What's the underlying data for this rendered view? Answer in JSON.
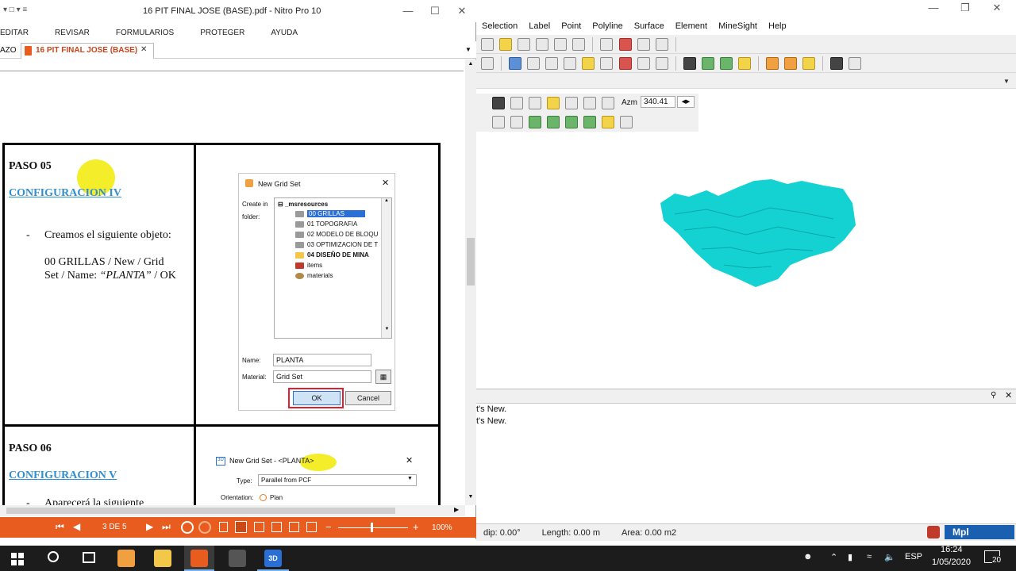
{
  "minesight": {
    "menu": [
      "Selection",
      "Label",
      "Point",
      "Polyline",
      "Surface",
      "Element",
      "MineSight",
      "Help"
    ],
    "azm_label": "Azm",
    "azm_value": "340.41",
    "messages": [
      "t's New.",
      "t's New."
    ],
    "status": {
      "dip": "dip: 0.00°",
      "length": "Length: 0.00 m",
      "area": "Area: 0.00 m2"
    },
    "mpl_label": "Mpl",
    "solid_color": "#14d2d2"
  },
  "nitro": {
    "title": "16 PIT FINAL JOSE (BASE).pdf - Nitro Pro 10",
    "ribbon": [
      "EDITAR",
      "REVISAR",
      "FORMULARIOS",
      "PROTEGER",
      "AYUDA"
    ],
    "tab_left": "AZO",
    "doc_tab": "16 PIT FINAL JOSE (BASE)",
    "page_indicator": "3 DE 5",
    "zoom": "100%",
    "accent": "#e85c1f"
  },
  "doc": {
    "step5": {
      "title": "PASO 05",
      "link": "CONFIGURACION IV",
      "bullet": "-",
      "line1": "Creamos el siguiente objeto:",
      "line2": "00 GRILLAS / New / Grid",
      "line3a": "Set / Name: ",
      "line3b": "“PLANTA”",
      "line3c": " / OK"
    },
    "step6": {
      "title": "PASO 06",
      "link": "CONFIGURACION V",
      "bullet": "-",
      "line1": "Aparecerá la siguiente"
    },
    "dialog1": {
      "title": "New Grid Set",
      "create_in": "Create in",
      "folder": "folder:",
      "root": "_msresources",
      "items": [
        "00 GRILLAS",
        "01 TOPOGRAFIA",
        "02 MODELO DE BLOQU",
        "03 OPTIMIZACION DE T",
        "04 DISEÑO DE MINA",
        "items",
        "materials"
      ],
      "name_label": "Name:",
      "name_value": "PLANTA",
      "material_label": "Material:",
      "material_value": "Grid Set",
      "ok": "OK",
      "cancel": "Cancel"
    },
    "dialog2": {
      "title": "New Grid Set - <PLANTA>",
      "type_label": "Type:",
      "type_value": "Parallel from PCF",
      "orientation_label": "Orientation:",
      "orientation_value": "Plan"
    }
  },
  "taskbar": {
    "lang": "ESP",
    "time": "16:24",
    "date": "1/05/2020",
    "notif_count": "20"
  }
}
